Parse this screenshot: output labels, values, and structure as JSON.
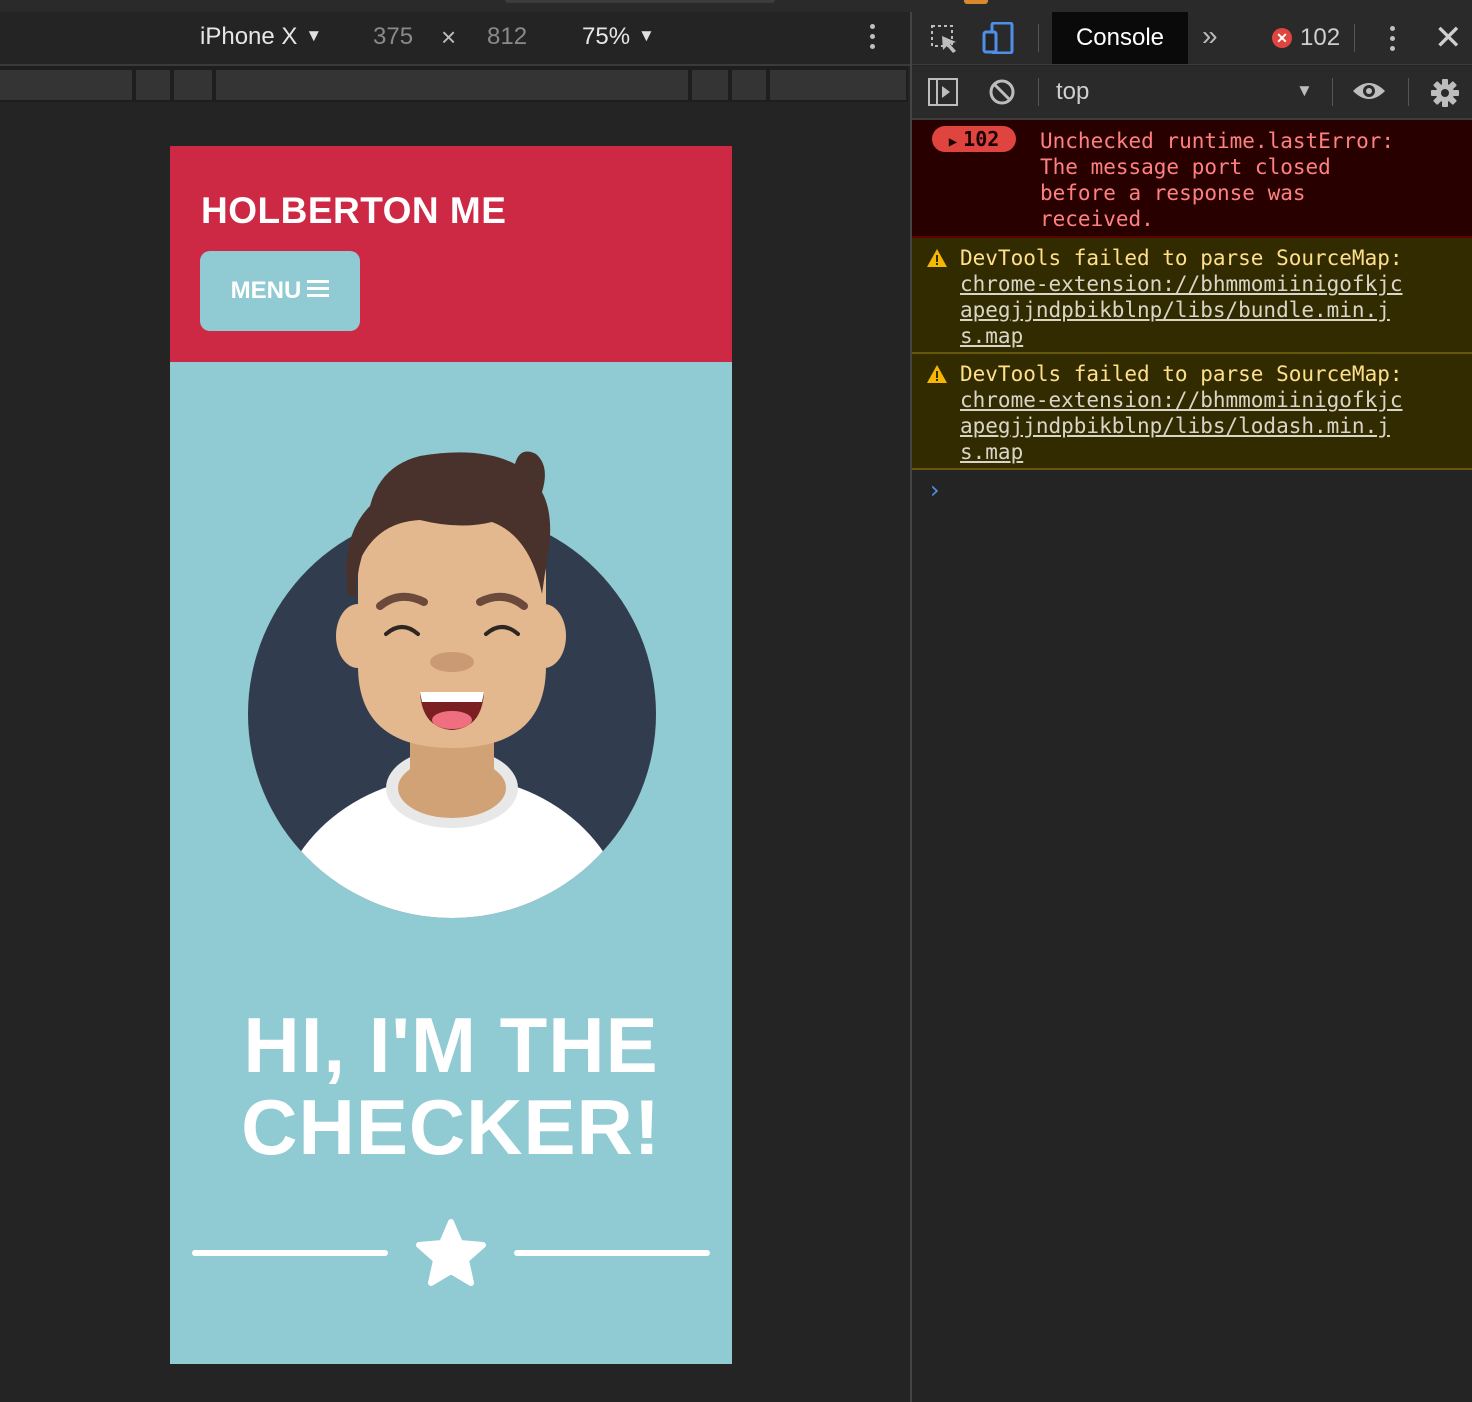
{
  "device_toolbar": {
    "device": "iPhone X",
    "width": "375",
    "times": "×",
    "height": "812",
    "zoom": "75%"
  },
  "page": {
    "site_title": "HOLBERTON ME",
    "menu_label": "MENU",
    "hero_line1": "HI, I'M THE",
    "hero_line2": "CHECKER!"
  },
  "devtools": {
    "active_tab": "Console",
    "more_tabs": "»",
    "error_count": "102",
    "context": "top",
    "messages": [
      {
        "level": "error",
        "count": "102",
        "lines": [
          "Unchecked runtime.lastError:",
          "The message port closed",
          "before a response was",
          "received."
        ]
      },
      {
        "level": "warning",
        "text": "DevTools failed to parse SourceMap:",
        "link_lines": [
          "chrome-extension://bhmmomiinigofkjc",
          "apegjjndpbikblnp/libs/bundle.min.j",
          "s.map"
        ]
      },
      {
        "level": "warning",
        "text": "DevTools failed to parse SourceMap:",
        "link_lines": [
          "chrome-extension://bhmmomiinigofkjc",
          "apegjjndpbikblnp/libs/lodash.min.j",
          "s.map"
        ]
      }
    ],
    "prompt": "›"
  },
  "colors": {
    "header_red": "#cd2944",
    "page_teal": "#90cad2",
    "avatar_navy": "#323c4f",
    "hair": "#4a322c",
    "skin": "#e3b88e"
  }
}
